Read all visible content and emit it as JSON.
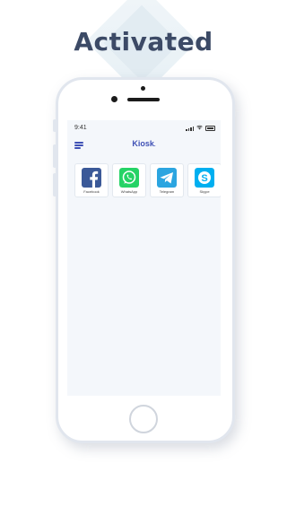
{
  "header": {
    "title": "Activated"
  },
  "status_bar": {
    "time": "9:41",
    "icons": [
      "signal-icon",
      "wifi-icon",
      "battery-icon"
    ]
  },
  "app_bar": {
    "menu_icon": "hamburger-menu-icon",
    "brand": "Kiosk",
    "brand_suffix": "."
  },
  "apps": [
    {
      "label": "Facebook",
      "icon": "facebook-icon",
      "color": "#3b5998"
    },
    {
      "label": "WhatsApp",
      "icon": "whatsapp-icon",
      "color": "#25d366"
    },
    {
      "label": "Telegram",
      "icon": "telegram-icon",
      "color": "#2ca5e0"
    },
    {
      "label": "Skype",
      "icon": "skype-icon",
      "color": "#00aff0"
    }
  ],
  "colors": {
    "title": "#3c4a66",
    "accent": "#3f51b5",
    "screen_bg": "#f4f7fb"
  }
}
